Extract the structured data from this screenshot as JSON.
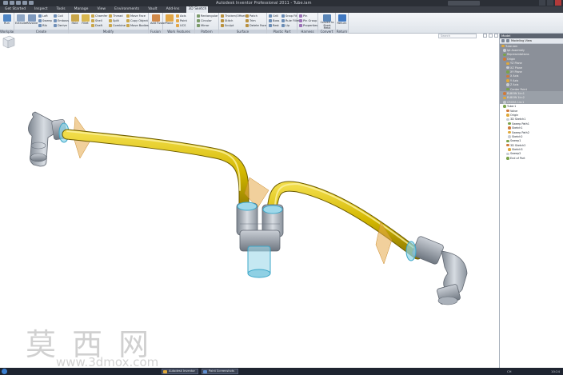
{
  "window": {
    "title": "Autodesk Inventor Professional 2011 - Tube.iam"
  },
  "tabs": [
    "Get Started",
    "Inspect",
    "Tools",
    "Manage",
    "View",
    "Environments",
    "Vault",
    "Add-Ins",
    "3D Sketch"
  ],
  "ribbon": {
    "panels": [
      {
        "label": "Workplane",
        "big": [
          "Run"
        ]
      },
      {
        "label": "Create",
        "big": [
          "Extrude",
          "Revolve"
        ],
        "small": [
          "Loft",
          "Sweep",
          "Rib"
        ],
        "small2": [
          "Coil",
          "Emboss",
          "Derive"
        ]
      },
      {
        "label": "Modify",
        "big": [
          "Hole",
          "Fillet"
        ],
        "small": [
          "Chamfer",
          "Shell",
          "Draft"
        ],
        "small2": [
          "Thread",
          "Split",
          "Combine"
        ],
        "small3": [
          "Move Face",
          "Copy Object",
          "Move Bodies"
        ]
      },
      {
        "label": "Fusion",
        "big": [
          "Add Fusion"
        ]
      },
      {
        "label": "Work Features",
        "big": [
          "Plane"
        ],
        "small": [
          "Axis",
          "Point",
          "UCS"
        ]
      },
      {
        "label": "Pattern",
        "small": [
          "Rectangular",
          "Circular",
          "Mirror"
        ]
      },
      {
        "label": "Surface",
        "small": [
          "Thicken/Offset",
          "Stitch",
          "Sculpt"
        ],
        "small2": [
          "Patch",
          "Trim",
          "Delete Face"
        ]
      },
      {
        "label": "Plastic Part",
        "small": [
          "Grill",
          "Boss",
          "Rest"
        ],
        "small2": [
          "Snap Fit",
          "Rule Fillet",
          "Lip"
        ]
      },
      {
        "label": "Harness",
        "small": [
          "Pin",
          "Pin Group",
          "Properties"
        ]
      },
      {
        "label": "Convert",
        "big": [
          "Convert to Sheet Metal"
        ]
      },
      {
        "label": "Return",
        "big": [
          "Return"
        ]
      }
    ]
  },
  "viewport": {
    "search_placeholder": "Search",
    "watermark_cn": "莫 西 网",
    "watermark_url": "www.3dmox.com"
  },
  "browser": {
    "title": "Model",
    "view_select": "Modeling View",
    "nodes": [
      {
        "label": "Tube.iam",
        "style": "gray"
      },
      {
        "label": "Ipt Assembly",
        "style": "gray"
      },
      {
        "label": "Representations",
        "style": "gray"
      },
      {
        "label": "Origin",
        "style": "gray"
      },
      {
        "label": "YZ Plane",
        "style": "gray"
      },
      {
        "label": "XZ Plane",
        "style": "gray"
      },
      {
        "label": "XY Plane",
        "style": "gray"
      },
      {
        "label": "X Axis",
        "style": "gray"
      },
      {
        "label": "Y Axis",
        "style": "gray"
      },
      {
        "label": "Z Axis",
        "style": "gray"
      },
      {
        "label": "Center Point",
        "style": "gray"
      },
      {
        "label": "ELBOW 1in:1",
        "style": "gray2"
      },
      {
        "label": "ELBOW 1in:2",
        "style": "gray2"
      },
      {
        "label": "CROSS 1in:1",
        "style": "gray2"
      },
      {
        "label": "Tube:1",
        "style": "normal"
      },
      {
        "label": "Valve",
        "style": "normal"
      },
      {
        "label": "Origin",
        "style": "normal"
      },
      {
        "label": "3D Sketch1",
        "style": "normal"
      },
      {
        "label": "Sweep Path1",
        "style": "normal"
      },
      {
        "label": "Sketch1",
        "style": "normal"
      },
      {
        "label": "Sweep Path2",
        "style": "normal"
      },
      {
        "label": "Sketch2",
        "style": "normal"
      },
      {
        "label": "Sweep1",
        "style": "normal"
      },
      {
        "label": "3D Sketch2",
        "style": "normal"
      },
      {
        "label": "Sketch3",
        "style": "normal"
      },
      {
        "label": "Sweep2",
        "style": "normal"
      },
      {
        "label": "End of Part",
        "style": "normal"
      }
    ]
  },
  "taskbar": {
    "buttons": [
      "Autodesk Inventor",
      "Paint Screenshots"
    ],
    "lang": "CH",
    "clock": "10:24"
  },
  "colors": {
    "tube": "#d4b800",
    "tube_dark": "#8f7a00",
    "fitting": "#9aa3ad",
    "highlight": "#5fc3e0",
    "plane": "#e6a94a"
  }
}
